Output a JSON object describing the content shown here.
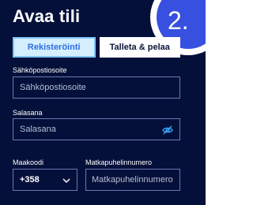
{
  "header": {
    "title": "Avaa tili",
    "step": "2."
  },
  "tabs": [
    {
      "label": "Rekisteröinti",
      "active": true
    },
    {
      "label": "Talleta & pelaa",
      "active": false
    }
  ],
  "email": {
    "label": "Sähköpostiosoite",
    "placeholder": "Sähköpostiosoite",
    "value": ""
  },
  "password": {
    "label": "Salasana",
    "placeholder": "Salasana",
    "value": "",
    "icon": "eye-slash-icon"
  },
  "country_code": {
    "label": "Maakoodi",
    "selected": "+358",
    "icon": "chevron-down-icon"
  },
  "phone": {
    "label": "Matkapuhelinnumero",
    "placeholder": "Matkapuhelinnumero",
    "value": ""
  },
  "colors": {
    "background": "#05103a",
    "accent": "#3750e0",
    "active_tab_bg": "#d6efff",
    "active_tab_text": "#2c6fe0"
  }
}
